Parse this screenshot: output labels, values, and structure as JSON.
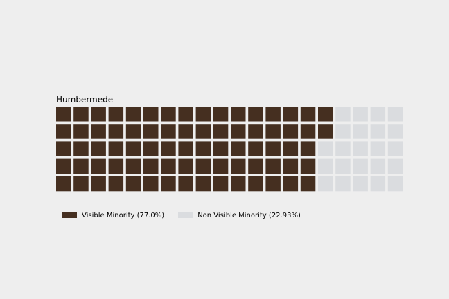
{
  "chart_data": {
    "type": "waffle",
    "title": "Humbermede",
    "rows": 5,
    "columns": 20,
    "fill_order": "column-major, top to bottom",
    "series": [
      {
        "name": "Visible Minority",
        "label": "Visible Minority (77.0%)",
        "percent": 77.0,
        "cells": 77,
        "color": "#452f20"
      },
      {
        "name": "Non Visible Minority",
        "label": "Non Visible Minority (22.93%)",
        "percent": 22.93,
        "cells": 23,
        "color": "#dadcdf"
      }
    ],
    "legend_position": "bottom-left"
  }
}
